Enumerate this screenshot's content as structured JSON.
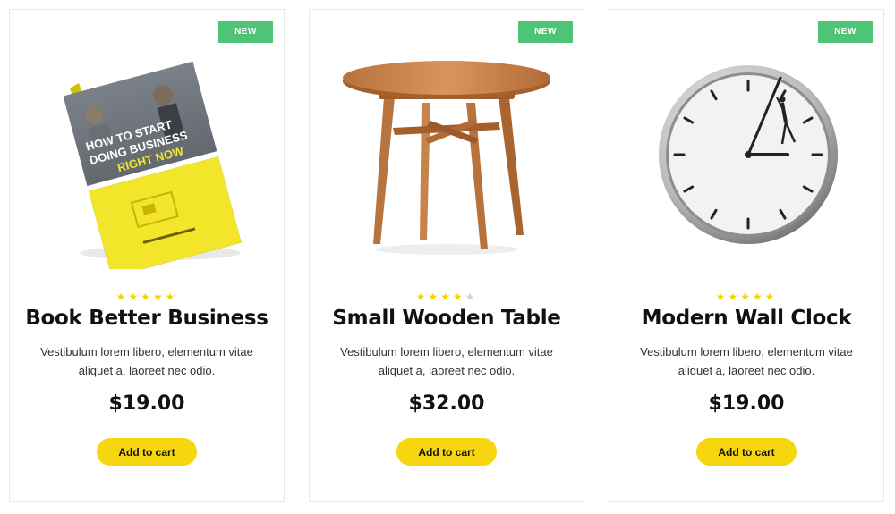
{
  "products": [
    {
      "badge": "NEW",
      "image_icon": "book-icon",
      "cover_text": [
        "HOW TO START",
        "DOING BUSINESS",
        "RIGHT NOW"
      ],
      "rating": 5,
      "title": "Book Better Business",
      "description": "Vestibulum lorem libero, elementum vitae aliquet a, laoreet nec odio.",
      "price": "$19.00",
      "button_label": "Add to cart"
    },
    {
      "badge": "NEW",
      "image_icon": "table-icon",
      "rating": 4,
      "title": "Small Wooden Table",
      "description": "Vestibulum lorem libero, elementum vitae aliquet a, laoreet nec odio.",
      "price": "$32.00",
      "button_label": "Add to cart"
    },
    {
      "badge": "NEW",
      "image_icon": "clock-icon",
      "rating": 5,
      "title": "Modern Wall Clock",
      "description": "Vestibulum lorem libero, elementum vitae aliquet a, laoreet nec odio.",
      "price": "$19.00",
      "button_label": "Add to cart"
    }
  ],
  "colors": {
    "badge": "#4fc476",
    "button": "#f5d60f",
    "star_on": "#f5d300",
    "star_off": "#cfcfcf"
  }
}
